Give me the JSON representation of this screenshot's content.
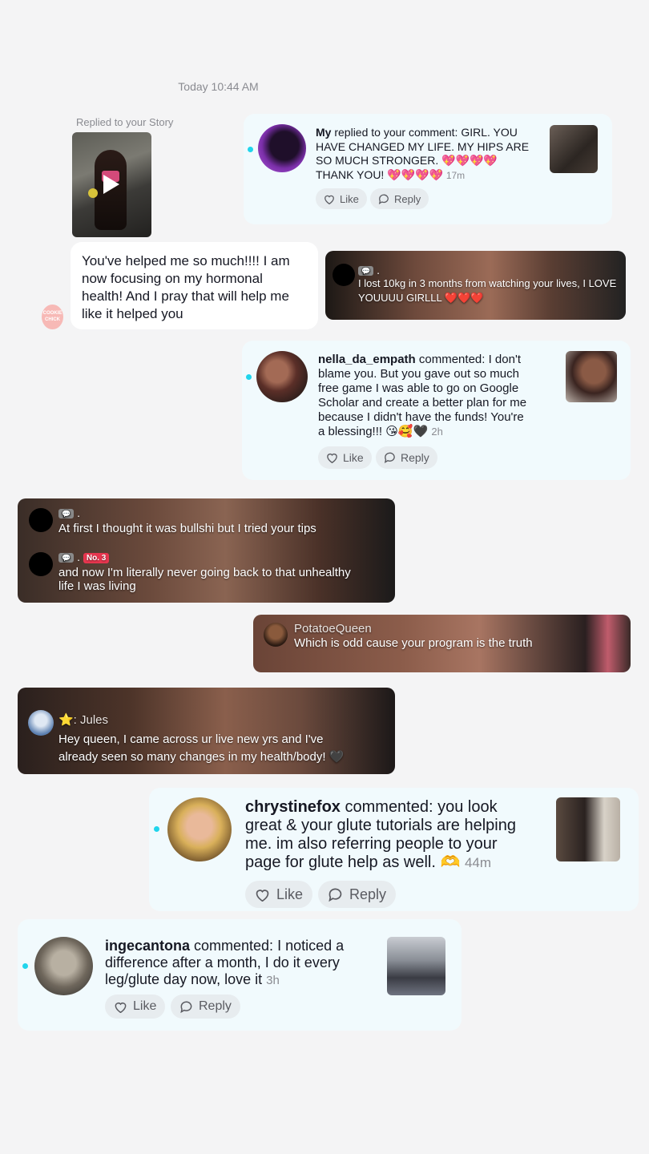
{
  "header": {
    "timestamp": "Today 10:44 AM"
  },
  "story_reply": {
    "label": "Replied to your Story"
  },
  "messages": {
    "bubble_text": "You've helped me so much!!!! I am now focusing on my hormonal health! And I pray that will help me like it helped you",
    "sticker_text": "COOKIE CHICK"
  },
  "notifications": [
    {
      "user": "My",
      "action": " replied to your comment: ",
      "lines": [
        "GIRL. YOU",
        "HAVE CHANGED MY LIFE. MY HIPS ARE",
        "SO MUCH STRONGER. 💖💖💖💖",
        "THANK YOU! 💖💖💖💖"
      ],
      "time": "17m",
      "like_label": "Like",
      "reply_label": "Reply"
    },
    {
      "user": "nella_da_empath",
      "action": " commented: ",
      "lines": [
        "I don't",
        "blame you. But you gave out so much",
        "free game I was able to go on Google",
        "Scholar and create a better plan for me",
        "because I didn't have the funds! You're",
        "a blessing!!! 😘🥰🖤"
      ],
      "time": "2h",
      "like_label": "Like",
      "reply_label": "Reply"
    },
    {
      "user": "chrystinefox",
      "action": " commented: ",
      "lines": [
        "you look",
        "great & your glute tutorials are helping",
        "me. im also referring people to your",
        "page for glute help as well. 🫶"
      ],
      "time": "44m",
      "like_label": "Like",
      "reply_label": "Reply"
    },
    {
      "user": "ingecantona",
      "action": " commented: ",
      "lines": [
        "I noticed a",
        "difference after a month, I do it every",
        "leg/glute day now, love it"
      ],
      "time": "3h",
      "like_label": "Like",
      "reply_label": "Reply"
    }
  ],
  "screenshots": [
    {
      "badge": ".",
      "lines": [
        "I lost 10kg in 3 months from watching your lives, I LOVE",
        "YOUUUU GIRLLL ❤️❤️❤️"
      ]
    },
    {
      "badge1": ".",
      "line1": "At first I thought it was bullshi but I tried your tips",
      "badge2": ".",
      "rank": "No. 3",
      "lines2": [
        "and now I'm literally never going back to that unhealthy",
        "life I was living"
      ]
    },
    {
      "name": "PotatoeQueen",
      "line": "Which is odd cause your program is the truth"
    },
    {
      "name": "⭐: Jules",
      "lines": [
        "Hey queen, I came across ur live new yrs and I've",
        "already seen so many changes in my health/body! 🖤"
      ]
    }
  ]
}
